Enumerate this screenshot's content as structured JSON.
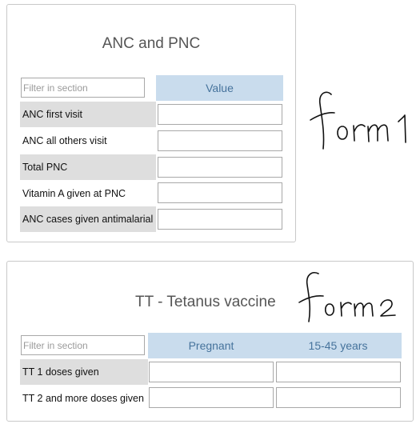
{
  "sections": [
    {
      "title": "ANC and PNC",
      "filter_placeholder": "Filter in section",
      "columns": [
        "Value"
      ],
      "rows": [
        {
          "label": "ANC first visit",
          "values": [
            ""
          ]
        },
        {
          "label": "ANC all others visit",
          "values": [
            ""
          ]
        },
        {
          "label": "Total PNC",
          "values": [
            ""
          ]
        },
        {
          "label": "Vitamin A given at PNC",
          "values": [
            ""
          ]
        },
        {
          "label": "ANC cases given antimalarial",
          "values": [
            ""
          ]
        }
      ]
    },
    {
      "title": "TT - Tetanus vaccine",
      "filter_placeholder": "Filter in section",
      "columns": [
        "Pregnant",
        "15-45 years"
      ],
      "rows": [
        {
          "label": "TT 1 doses given",
          "values": [
            "",
            ""
          ]
        },
        {
          "label": "TT 2 and more doses given",
          "values": [
            "",
            ""
          ]
        }
      ]
    }
  ],
  "annotations": {
    "form1": "form1",
    "form2": "form2"
  }
}
